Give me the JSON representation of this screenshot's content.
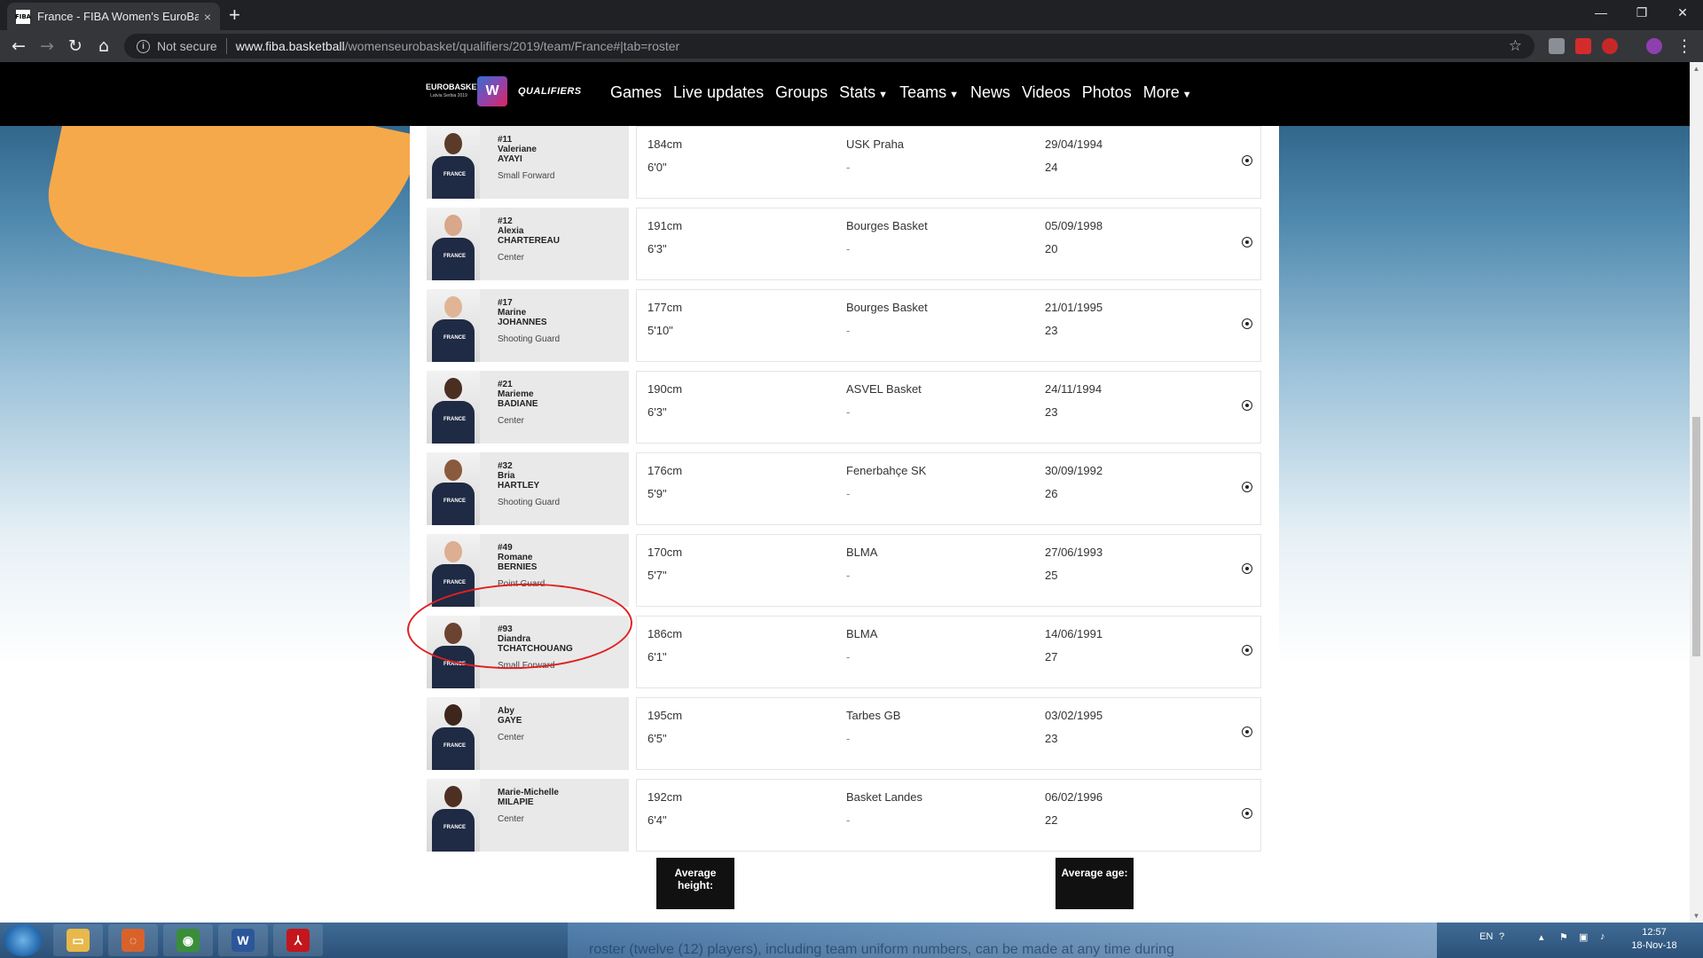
{
  "browser": {
    "tab_title": "France - FIBA Women's EuroBask",
    "tab_favicon": "FIBA",
    "tab_close": "×",
    "new_tab": "+",
    "not_secure": "Not secure",
    "url_domain": "www.fiba.basketball",
    "url_path": "/womenseurobasket/qualifiers/2019/team/France#|tab=roster",
    "window_controls": [
      "—",
      "❐",
      "✕"
    ]
  },
  "site": {
    "logo_top": "EUROBASKET",
    "logo_sub": "Latvia Serbia 2019",
    "logo_mark": "W",
    "qualifiers": "QUALIFIERS",
    "menu": [
      {
        "label": "Games",
        "dropdown": false
      },
      {
        "label": "Live updates",
        "dropdown": false
      },
      {
        "label": "Groups",
        "dropdown": false
      },
      {
        "label": "Stats",
        "dropdown": true
      },
      {
        "label": "Teams",
        "dropdown": true
      },
      {
        "label": "News",
        "dropdown": false
      },
      {
        "label": "Videos",
        "dropdown": false
      },
      {
        "label": "Photos",
        "dropdown": false
      },
      {
        "label": "More",
        "dropdown": true
      }
    ]
  },
  "roster": [
    {
      "number": "#11",
      "first": "Valeriane",
      "last": "AYAYI",
      "position": "Small Forward",
      "height_cm": "184cm",
      "height_ft": "6'0\"",
      "club": "USK Praha",
      "club_sub": "-",
      "dob": "29/04/1994",
      "age": "24",
      "skin": "#5a3a28",
      "jersey": "FRANCE"
    },
    {
      "number": "#12",
      "first": "Alexia",
      "last": "CHARTEREAU",
      "position": "Center",
      "height_cm": "191cm",
      "height_ft": "6'3\"",
      "club": "Bourges Basket",
      "club_sub": "-",
      "dob": "05/09/1998",
      "age": "20",
      "skin": "#d9a78a",
      "jersey": "FRANCE"
    },
    {
      "number": "#17",
      "first": "Marine",
      "last": "JOHANNES",
      "position": "Shooting Guard",
      "height_cm": "177cm",
      "height_ft": "5'10\"",
      "club": "Bourges Basket",
      "club_sub": "-",
      "dob": "21/01/1995",
      "age": "23",
      "skin": "#e0b596",
      "jersey": "FRANCE"
    },
    {
      "number": "#21",
      "first": "Marieme",
      "last": "BADIANE",
      "position": "Center",
      "height_cm": "190cm",
      "height_ft": "6'3\"",
      "club": "ASVEL Basket",
      "club_sub": "-",
      "dob": "24/11/1994",
      "age": "23",
      "skin": "#4a2e20",
      "jersey": "FRANCE"
    },
    {
      "number": "#32",
      "first": "Bria",
      "last": "HARTLEY",
      "position": "Shooting Guard",
      "height_cm": "176cm",
      "height_ft": "5'9\"",
      "club": "Fenerbahçe SK",
      "club_sub": "-",
      "dob": "30/09/1992",
      "age": "26",
      "skin": "#8a5a3c",
      "jersey": "FRANCE"
    },
    {
      "number": "#49",
      "first": "Romane",
      "last": "BERNIES",
      "position": "Point Guard",
      "height_cm": "170cm",
      "height_ft": "5'7\"",
      "club": "BLMA",
      "club_sub": "-",
      "dob": "27/06/1993",
      "age": "25",
      "skin": "#dcae92",
      "jersey": "FRANCE"
    },
    {
      "number": "#93",
      "first": "Diandra",
      "last": "TCHATCHOUANG",
      "position": "Small Forward",
      "height_cm": "186cm",
      "height_ft": "6'1\"",
      "club": "BLMA",
      "club_sub": "-",
      "dob": "14/06/1991",
      "age": "27",
      "skin": "#6b4330",
      "jersey": "FRANCE"
    },
    {
      "number": "",
      "first": "Aby",
      "last": "GAYE",
      "position": "Center",
      "height_cm": "195cm",
      "height_ft": "6'5\"",
      "club": "Tarbes GB",
      "club_sub": "-",
      "dob": "03/02/1995",
      "age": "23",
      "skin": "#3d261b",
      "jersey": "FRANCE"
    },
    {
      "number": "",
      "first": "Marie-Michelle",
      "last": "MILAPIE",
      "position": "Center",
      "height_cm": "192cm",
      "height_ft": "6'4\"",
      "club": "Basket Landes",
      "club_sub": "-",
      "dob": "06/02/1996",
      "age": "22",
      "skin": "#4e3022",
      "jersey": "FRANCE"
    }
  ],
  "averages": {
    "height_label": "Average height:",
    "age_label": "Average age:"
  },
  "taskbar": {
    "apps": [
      {
        "name": "explorer",
        "glyph": "▭",
        "color": "#e8b84a"
      },
      {
        "name": "app",
        "glyph": "◌",
        "color": "#d9622b"
      },
      {
        "name": "chrome",
        "glyph": "◉",
        "color": "#3a8e3a"
      },
      {
        "name": "word",
        "glyph": "W",
        "color": "#2b579a"
      },
      {
        "name": "acrobat",
        "glyph": "⅄",
        "color": "#c4161c"
      }
    ],
    "toast_text": "roster (twelve (12) players), including team uniform numbers, can be made at any time during",
    "lang": "EN",
    "time": "12:57",
    "date": "18-Nov-18"
  }
}
